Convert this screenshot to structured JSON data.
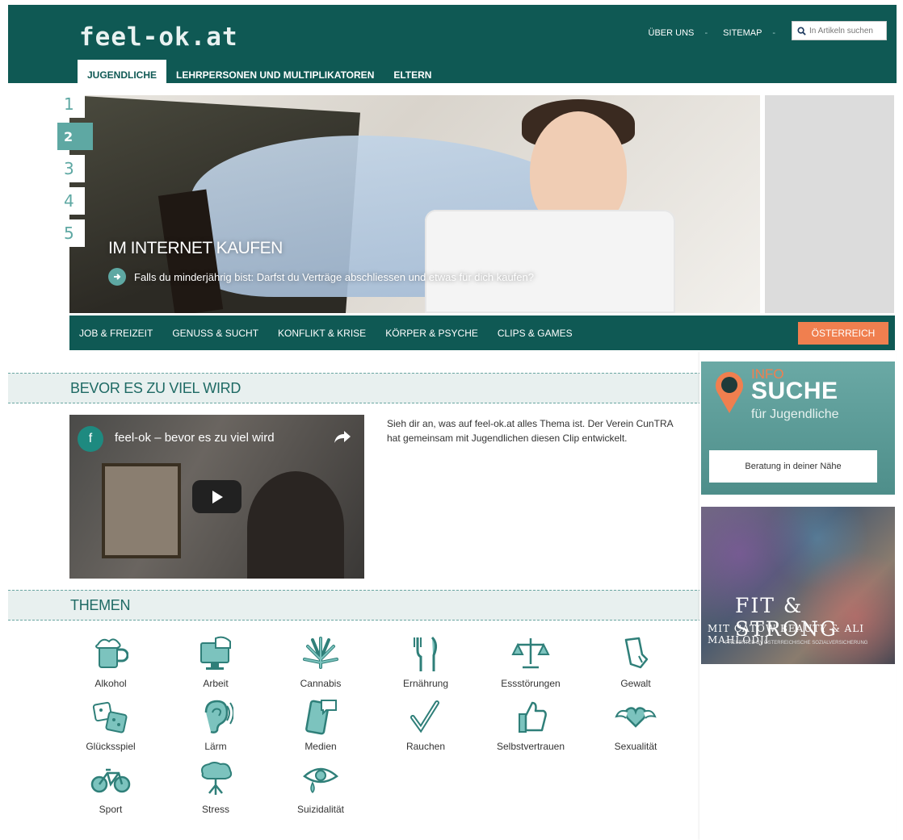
{
  "header": {
    "logo": "feel-ok.at",
    "links": [
      "ÜBER UNS",
      "SITEMAP"
    ],
    "search_placeholder": "In Artikeln suchen",
    "tabs": [
      "JUGENDLICHE",
      "LEHRPERSONEN UND MULTIPLIKATOREN",
      "ELTERN"
    ]
  },
  "hero": {
    "slide_numbers": [
      "1",
      "2",
      "3",
      "4",
      "5"
    ],
    "active_slide": "2",
    "title": "IM INTERNET KAUFEN",
    "subtitle": "Falls du minderjährig bist: Darfst du Verträge abschliessen und etwas für dich kaufen?"
  },
  "categories": [
    "JOB & FREIZEIT",
    "GENUSS & SUCHT",
    "KONFLIKT & KRISE",
    "KÖRPER & PSYCHE",
    "CLIPS & GAMES"
  ],
  "country_button": "ÖSTERREICH",
  "section1": {
    "title": "BEVOR ES ZU VIEL WIRD",
    "video_title": "feel-ok – bevor es zu viel wird",
    "video_channel_letter": "f",
    "text": "Sieh dir an, was auf feel-ok.at alles Thema ist. Der Verein CunTRA hat gemeinsam mit Jugendlichen diesen Clip entwickelt."
  },
  "section2": {
    "title": "THEMEN",
    "topics": [
      "Alkohol",
      "Arbeit",
      "Cannabis",
      "Ernährung",
      "Essstörungen",
      "Gewalt",
      "Glücksspiel",
      "Lärm",
      "Medien",
      "Rauchen",
      "Selbstvertrauen",
      "Sexualität",
      "Sport",
      "Stress",
      "Suizidalität"
    ]
  },
  "sidebar": {
    "info_line1": "INFO",
    "info_line2": "SUCHE",
    "info_line3": "für Jugendliche",
    "info_button": "Beratung in deiner Nähe",
    "promo_line1": "FIT & STRONG",
    "promo_line2": "MIT CATOW BEAUTY & ALI MAHLODJI",
    "promo_line3": "PRESENTED BY ÖSTERREICHISCHE SOZIALVERSICHERUNG"
  },
  "colors": {
    "primary": "#0f5954",
    "accent_teal": "#5ea8a3",
    "accent_orange": "#f07f4f"
  }
}
